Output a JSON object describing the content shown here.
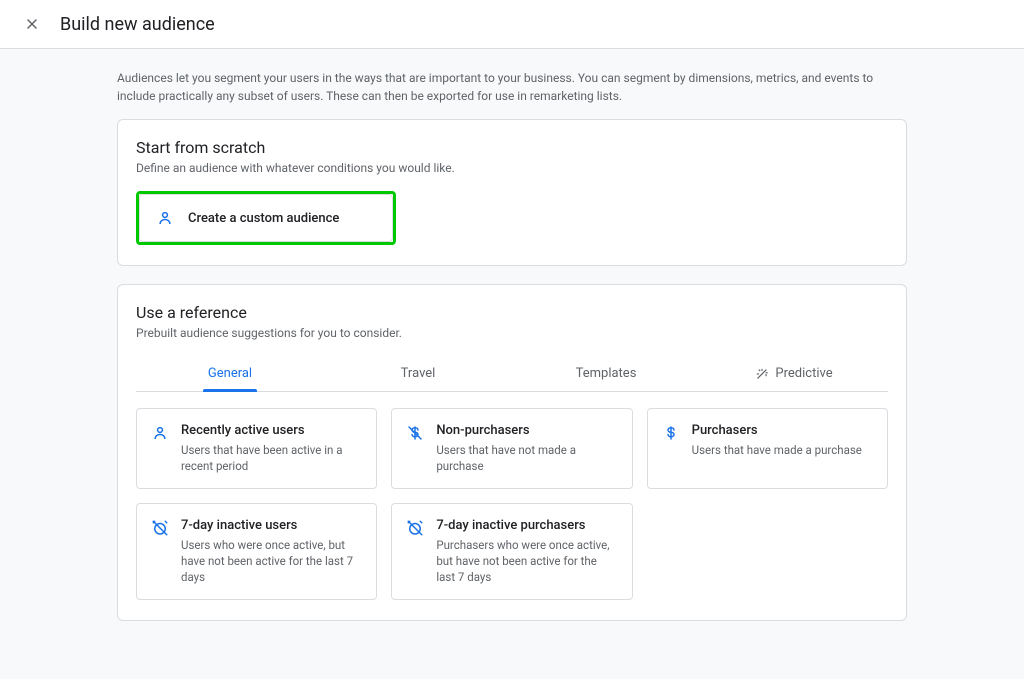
{
  "header": {
    "title": "Build new audience"
  },
  "intro": "Audiences let you segment your users in the ways that are important to your business. You can segment by dimensions, metrics, and events to include practically any subset of users. These can then be exported for use in remarketing lists.",
  "scratch": {
    "title": "Start from scratch",
    "subtitle": "Define an audience with whatever conditions you would like.",
    "button_label": "Create a custom audience"
  },
  "reference": {
    "title": "Use a reference",
    "subtitle": "Prebuilt audience suggestions for you to consider.",
    "tabs": [
      {
        "label": "General"
      },
      {
        "label": "Travel"
      },
      {
        "label": "Templates"
      },
      {
        "label": "Predictive"
      }
    ],
    "suggestions": [
      {
        "title": "Recently active users",
        "desc": "Users that have been active in a recent period",
        "icon": "person"
      },
      {
        "title": "Non-purchasers",
        "desc": "Users that have not made a purchase",
        "icon": "no-dollar"
      },
      {
        "title": "Purchasers",
        "desc": "Users that have made a purchase",
        "icon": "dollar"
      },
      {
        "title": "7-day inactive users",
        "desc": "Users who were once active, but have not been active for the last 7 days",
        "icon": "no-alarm"
      },
      {
        "title": "7-day inactive purchasers",
        "desc": "Purchasers who were once active, but have not been active for the last 7 days",
        "icon": "no-alarm"
      }
    ]
  }
}
